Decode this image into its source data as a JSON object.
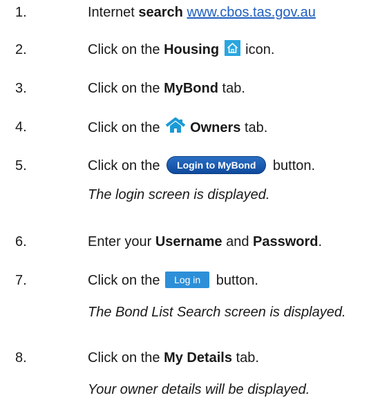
{
  "steps": [
    {
      "num": "1.",
      "pre": "Internet ",
      "bold": "search",
      "link": "www.cbos.tas.gov.au"
    },
    {
      "num": "2.",
      "pre": "Click on the ",
      "bold": "Housing",
      "post": " icon."
    },
    {
      "num": "3.",
      "pre": "Click on the ",
      "bold": "MyBond",
      "post": " tab."
    },
    {
      "num": "4.",
      "pre": "Click on the ",
      "bold": "Owners",
      "post": " tab."
    },
    {
      "num": "5.",
      "pre": "Click on the ",
      "button": "Login to MyBond",
      "post": " button.",
      "note": "The login screen is displayed."
    },
    {
      "num": "6.",
      "pre": "Enter your ",
      "bold": "Username",
      "mid": " and ",
      "bold2": "Password",
      "post": "."
    },
    {
      "num": "7.",
      "pre": "Click on the ",
      "button": "Log in",
      "post": " button.",
      "note": "The Bond List Search screen is displayed."
    },
    {
      "num": "8.",
      "pre": "Click on the ",
      "bold": "My Details",
      "post": " tab.",
      "note": "Your owner details will be displayed."
    }
  ],
  "colors": {
    "link": "#1f5fbf",
    "housing_icon_bg": "#29a6e0",
    "owners_icon": "#1b9ad6",
    "mybond_button": "#1555ad",
    "login_button": "#2d8fd8"
  },
  "icons": {
    "housing": "house-icon",
    "owners": "house-roof-icon"
  }
}
